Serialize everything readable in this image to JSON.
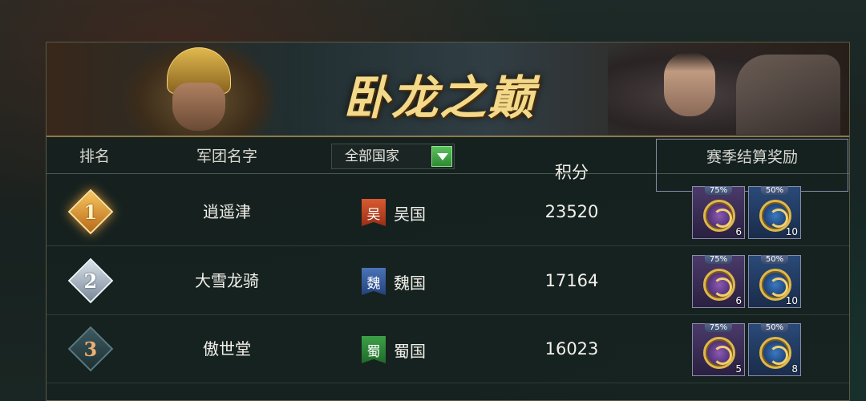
{
  "banner": {
    "title": "卧龙之巅"
  },
  "header": {
    "rank": "排名",
    "legion_name": "军团名字",
    "filter_value": "全部国家",
    "score": "积分",
    "season_reward": "赛季结算奖励"
  },
  "rows": [
    {
      "rank": "1",
      "legion": "逍遥津",
      "flag": "吴",
      "nation": "吴国",
      "score": "23520",
      "rewards": [
        {
          "percent": "75%",
          "count": "6",
          "icon": "purple-token-icon"
        },
        {
          "percent": "50%",
          "count": "10",
          "icon": "blue-token-icon"
        }
      ]
    },
    {
      "rank": "2",
      "legion": "大雪龙骑",
      "flag": "魏",
      "nation": "魏国",
      "score": "17164",
      "rewards": [
        {
          "percent": "75%",
          "count": "6",
          "icon": "purple-token-icon"
        },
        {
          "percent": "50%",
          "count": "10",
          "icon": "blue-token-icon"
        }
      ]
    },
    {
      "rank": "3",
      "legion": "傲世堂",
      "flag": "蜀",
      "nation": "蜀国",
      "score": "16023",
      "rewards": [
        {
          "percent": "75%",
          "count": "5",
          "icon": "purple-token-icon"
        },
        {
          "percent": "50%",
          "count": "8",
          "icon": "blue-token-icon"
        }
      ]
    }
  ],
  "colors": {
    "gold_title": "#f3d98a",
    "wu": "#c84a28",
    "wei": "#3a62a8",
    "shu": "#2e8a3a",
    "filter_green": "#3ea048"
  }
}
